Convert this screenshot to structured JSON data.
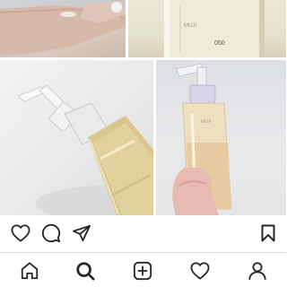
{
  "post": {
    "photos": [
      {
        "name": "hand-swatch-photo"
      },
      {
        "name": "bottle-closeup-photo"
      },
      {
        "name": "pump-bottle-photo"
      },
      {
        "name": "held-bottle-photo"
      }
    ],
    "bottle_label_text": "MUJI"
  },
  "actions": {
    "like_icon": "heart-icon",
    "comment_icon": "comment-icon",
    "share_icon": "send-icon",
    "save_icon": "bookmark-icon"
  },
  "bottom_nav": {
    "items": [
      "home-icon",
      "search-icon",
      "add-icon",
      "activity-icon",
      "profile-icon"
    ],
    "active": "search-icon"
  },
  "colors": {
    "icon": "#262626",
    "border": "#dbdbdb",
    "oil": "#d9c48a"
  }
}
